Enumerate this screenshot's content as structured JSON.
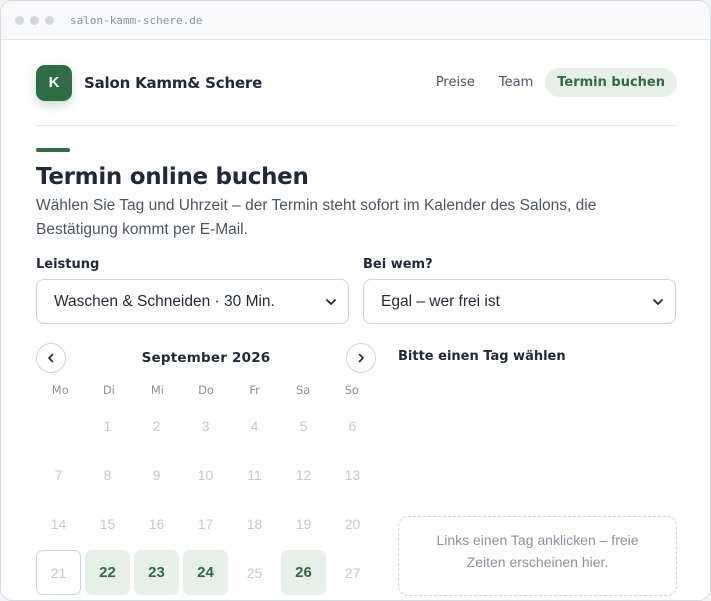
{
  "browser": {
    "url": "salon-kamm-schere.de"
  },
  "header": {
    "logo_letter": "K",
    "brand": "Salon Kamm& Schere",
    "nav": [
      {
        "label": "Preise",
        "active": false
      },
      {
        "label": "Team",
        "active": false
      },
      {
        "label": "Termin buchen",
        "active": true
      }
    ]
  },
  "main": {
    "title": "Termin online buchen",
    "intro": "Wählen Sie Tag und Uhrzeit – der Termin steht sofort im Kalender des Salons, die Bestätigung kommt per E-Mail.",
    "service": {
      "label": "Leistung",
      "value": "Waschen & Schneiden · 30 Min."
    },
    "staff": {
      "label": "Bei wem?",
      "value": "Egal – wer frei ist"
    }
  },
  "calendar": {
    "month": "September 2026",
    "weekdays": [
      "Mo",
      "Di",
      "Mi",
      "Do",
      "Fr",
      "Sa",
      "So"
    ],
    "days": [
      {
        "d": "",
        "state": "empty"
      },
      {
        "d": "1",
        "state": "past"
      },
      {
        "d": "2",
        "state": "past"
      },
      {
        "d": "3",
        "state": "past"
      },
      {
        "d": "4",
        "state": "past"
      },
      {
        "d": "5",
        "state": "past"
      },
      {
        "d": "6",
        "state": "past"
      },
      {
        "d": "7",
        "state": "past"
      },
      {
        "d": "8",
        "state": "past"
      },
      {
        "d": "9",
        "state": "past"
      },
      {
        "d": "10",
        "state": "past"
      },
      {
        "d": "11",
        "state": "past"
      },
      {
        "d": "12",
        "state": "past"
      },
      {
        "d": "13",
        "state": "past"
      },
      {
        "d": "14",
        "state": "past"
      },
      {
        "d": "15",
        "state": "past"
      },
      {
        "d": "16",
        "state": "past"
      },
      {
        "d": "17",
        "state": "past"
      },
      {
        "d": "18",
        "state": "past"
      },
      {
        "d": "19",
        "state": "past"
      },
      {
        "d": "20",
        "state": "past"
      },
      {
        "d": "21",
        "state": "today"
      },
      {
        "d": "22",
        "state": "available"
      },
      {
        "d": "23",
        "state": "available"
      },
      {
        "d": "24",
        "state": "available"
      },
      {
        "d": "25",
        "state": "past"
      },
      {
        "d": "26",
        "state": "available"
      },
      {
        "d": "27",
        "state": "past"
      }
    ]
  },
  "slots": {
    "title": "Bitte einen Tag wählen",
    "hint": "Links einen Tag anklicken – freie Zeiten erscheinen hier."
  },
  "colors": {
    "accent": "#2f6b43",
    "accent_light": "#e6efe8"
  }
}
